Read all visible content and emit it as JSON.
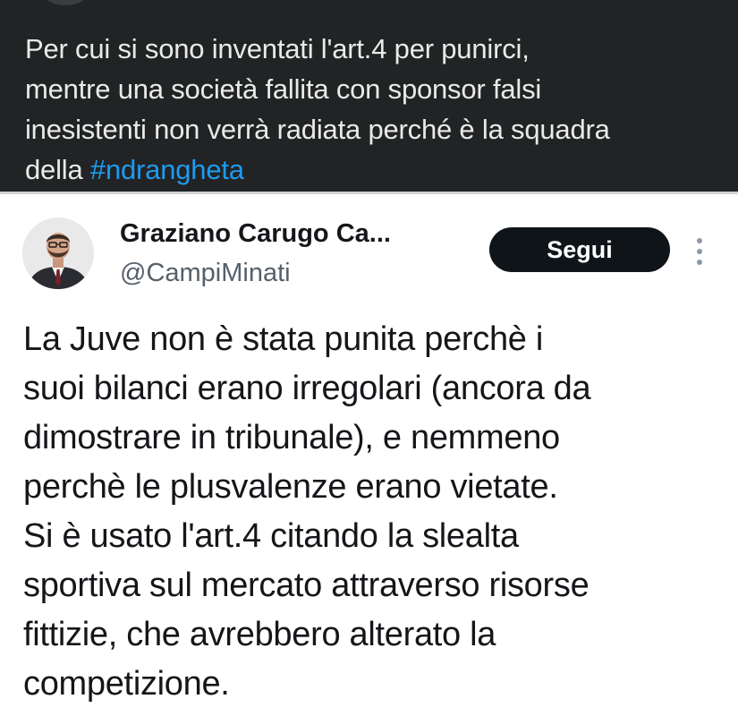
{
  "quote_tweet": {
    "lines": [
      "Per cui si sono inventati l'art.4 per punirci,",
      "mentre una società fallita con sponsor falsi",
      "inesistenti non verrà radiata perché è la squadra",
      "della "
    ],
    "hashtag": "#ndrangheta"
  },
  "embedded_tweet": {
    "author_name": "Graziano Carugo Ca...",
    "handle": "@CampiMinati",
    "follow_label": "Segui",
    "lines": [
      "La Juve non è stata punita perchè i",
      "suoi bilanci erano irregolari (ancora da",
      "dimostrare in tribunale), e nemmeno",
      "perchè le plusvalenze erano vietate.",
      "Si è usato l'art.4 citando la slealta",
      "sportiva sul mercato attraverso risorse",
      "fittizie, che avrebbero alterato la",
      "competizione."
    ]
  },
  "icons": {
    "avatar": "avatar-photo",
    "more": "more-vertical-icon"
  },
  "colors": {
    "dark_background": "#222324",
    "hashtag": "#1d9bf0",
    "follow_button": "#0f1419"
  }
}
